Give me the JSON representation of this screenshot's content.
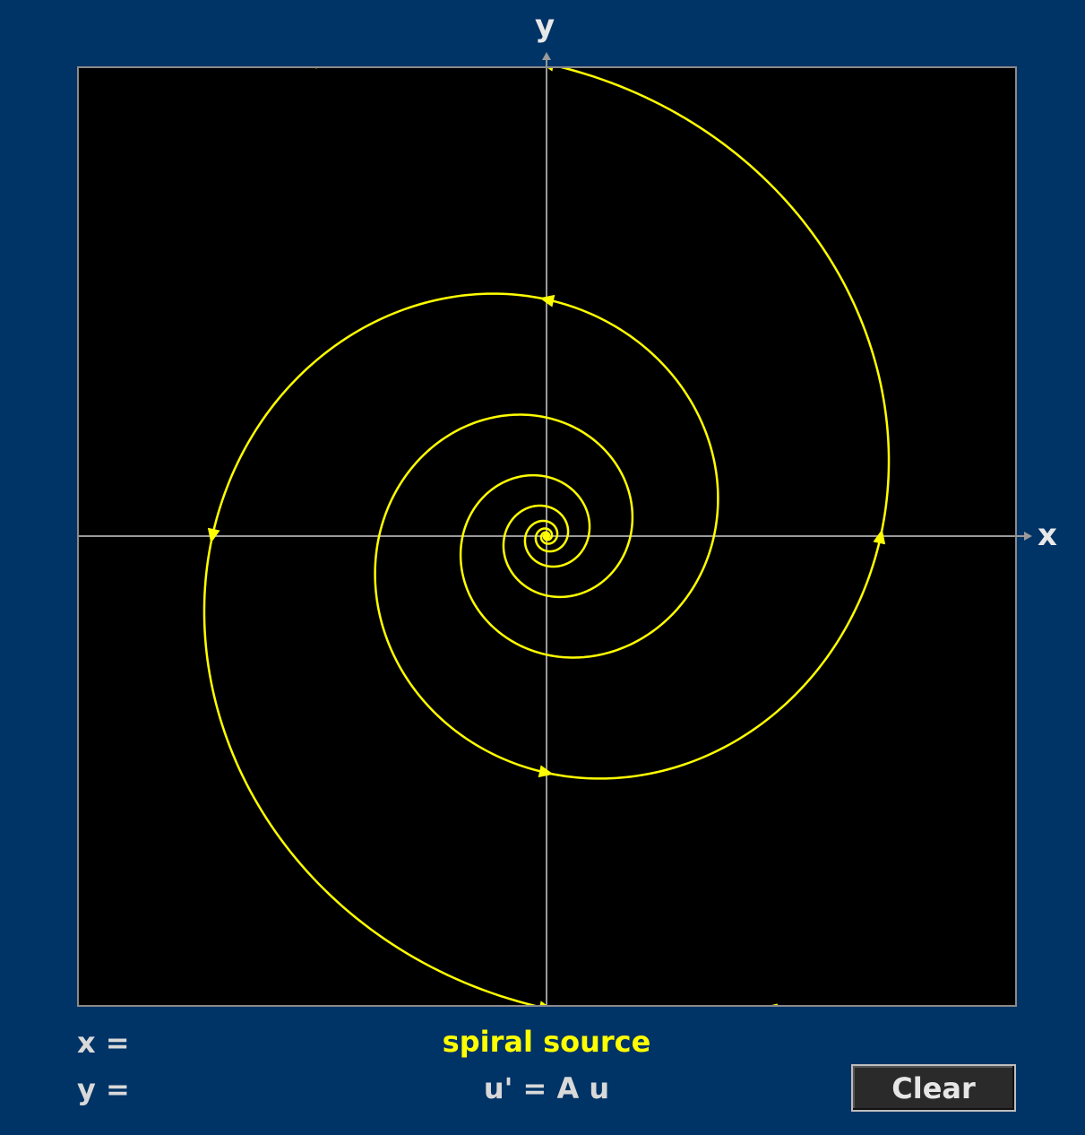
{
  "axes": {
    "x_label": "x",
    "y_label": "y"
  },
  "readouts": {
    "x_label": "x =",
    "y_label": "y ="
  },
  "system": {
    "type_label": "spiral source",
    "equation": "u' = A u"
  },
  "controls": {
    "clear_label": "Clear"
  },
  "colors": {
    "background": "#003366",
    "plot_background": "#000000",
    "axis": "#9a9a9a",
    "trajectory": "#ffff00",
    "type_label": "#ffff00",
    "text": "#d9d9d9"
  },
  "chart_data": {
    "type": "phase-portrait",
    "equation": "u' = A u",
    "classification": "spiral source",
    "trajectories": 2,
    "rotation": "counterclockwise",
    "grid": false
  }
}
